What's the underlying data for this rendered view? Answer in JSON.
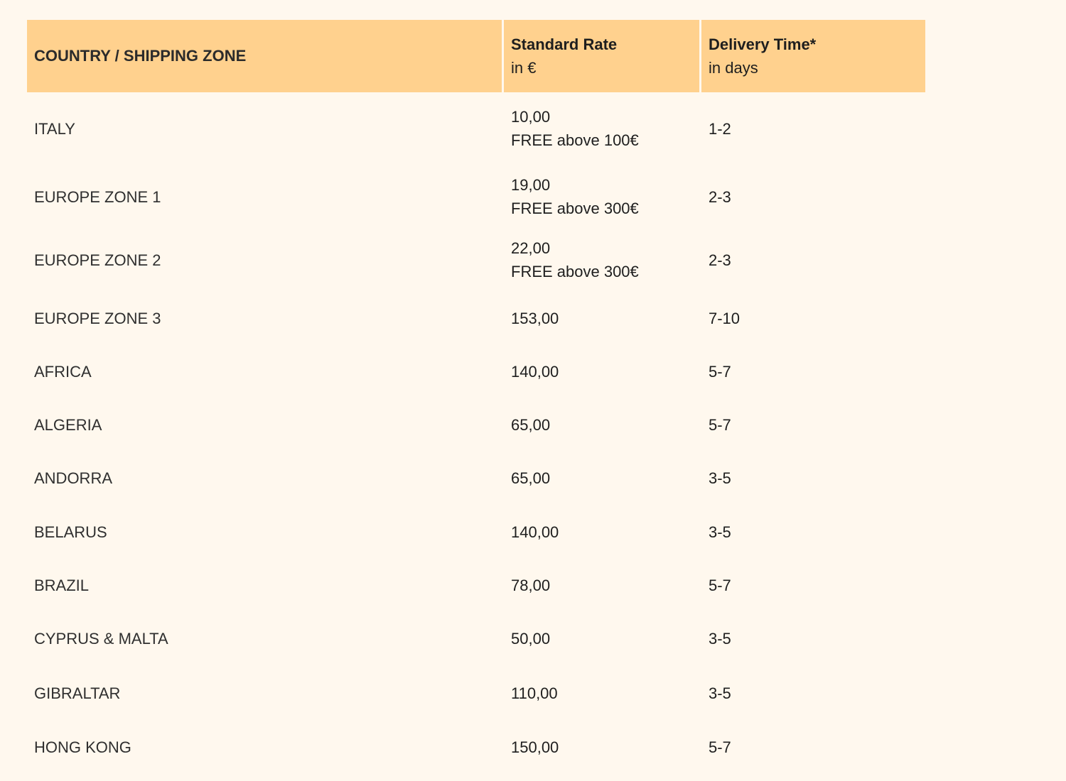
{
  "table": {
    "headers": {
      "zone": "COUNTRY / SHIPPING ZONE",
      "rate_title": "Standard Rate",
      "rate_unit": "in €",
      "time_title": "Delivery Time*",
      "time_unit": "in days"
    },
    "rows": [
      {
        "zone": "ITALY",
        "rate": "10,00",
        "rate_note": "FREE above 100€",
        "days": "1-2"
      },
      {
        "zone": "EUROPE ZONE 1",
        "rate": "19,00",
        "rate_note": "FREE above 300€",
        "days": "2-3"
      },
      {
        "zone": "EUROPE ZONE 2",
        "rate": "22,00",
        "rate_note": "FREE above 300€",
        "days": "2-3"
      },
      {
        "zone": "EUROPE ZONE 3",
        "rate": "153,00",
        "rate_note": "",
        "days": "7-10"
      },
      {
        "zone": "AFRICA",
        "rate": "140,00",
        "rate_note": "",
        "days": "5-7"
      },
      {
        "zone": "ALGERIA",
        "rate": "65,00",
        "rate_note": "",
        "days": "5-7"
      },
      {
        "zone": "ANDORRA",
        "rate": "65,00",
        "rate_note": "",
        "days": "3-5"
      },
      {
        "zone": "BELARUS",
        "rate": "140,00",
        "rate_note": "",
        "days": "3-5"
      },
      {
        "zone": "BRAZIL",
        "rate": "78,00",
        "rate_note": "",
        "days": "5-7"
      },
      {
        "zone": "CYPRUS & MALTA",
        "rate": "50,00",
        "rate_note": "",
        "days": "3-5"
      },
      {
        "zone": "GIBRALTAR",
        "rate": "110,00",
        "rate_note": "",
        "days": "3-5"
      },
      {
        "zone": "HONG KONG",
        "rate": "150,00",
        "rate_note": "",
        "days": "5-7"
      }
    ]
  },
  "colors": {
    "header_bg": "#ffd18e",
    "page_bg": "#fff8ee"
  }
}
